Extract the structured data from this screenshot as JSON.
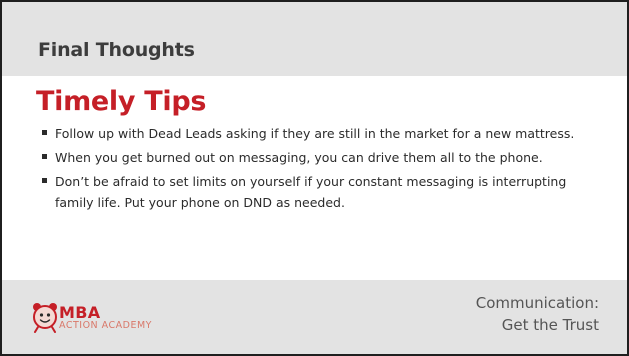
{
  "header": {
    "section_title": "Final Thoughts"
  },
  "main": {
    "heading": "Timely Tips",
    "tips": [
      "Follow up with Dead Leads asking if they are still in the market for a new mattress.",
      "When you get burned out on messaging, you can drive them all to the phone.",
      "Don’t be afraid to set limits on yourself if your constant messaging is interrupting family life. Put your phone on DND as needed."
    ]
  },
  "footer": {
    "logo": {
      "brand": "MBA",
      "tagline": "ACTION ACADEMY",
      "icon": "alarm-clock-mascot-icon"
    },
    "caption_line1": "Communication:",
    "caption_line2": "Get the Trust"
  },
  "colors": {
    "accent_red": "#c51f27",
    "band_gray": "#e3e3e3",
    "text_dark": "#2b2b2b"
  }
}
